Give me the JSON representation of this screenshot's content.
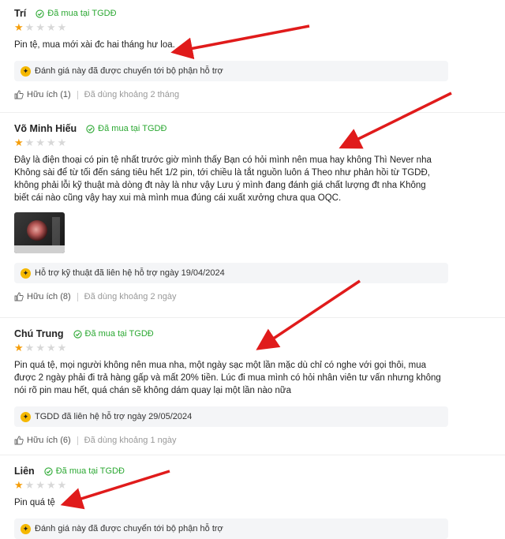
{
  "reviews": [
    {
      "name": "Trí",
      "verified": "Đã mua tại TGDĐ",
      "rating": 1,
      "content": "Pin tệ, mua mới xài đc hai tháng hư loa.",
      "reply": "Đánh giá này đã được chuyển tới bộ phận hỗ trợ",
      "helpful": "Hữu ích (1)",
      "used": "Đã dùng khoảng 2 tháng"
    },
    {
      "name": "Võ Minh Hiếu",
      "verified": "Đã mua tại TGDĐ",
      "rating": 1,
      "content": "Đây là điện thoại có pin tệ nhất trước giờ mình thấy Bạn có hỏi mình nên mua hay không Thì Never nha Không sài để từ tối đến sáng tiêu hết 1/2 pin, tới chiều là tắt nguồn luôn á Theo như phản hồi từ TGDĐ, không phải lỗi kỹ thuật mà dòng đt này là như vậy Lưu ý mình đang đánh giá chất lượng đt nha Không biết cái nào cũng vậy hay xui mà mình mua đúng cái xuất xưởng chưa qua OQC.",
      "reply": "Hỗ trợ kỹ thuật đã liên hệ hỗ trợ ngày 19/04/2024",
      "helpful": "Hữu ích (8)",
      "used": "Đã dùng khoảng 2 ngày"
    },
    {
      "name": "Chú Trung",
      "verified": "Đã mua tại TGDĐ",
      "rating": 1,
      "content": "Pin quá tệ, mọi người không nên mua nha, một ngày sạc một lần mặc dù chỉ có nghe với gọi thôi, mua được 2 ngày phải đi trả hàng gấp và mất 20% tiền. Lúc đi mua mình có hỏi nhân viên tư vấn nhưng không nói rõ pin mau hết, quá chán sẽ không dám quay lại một lần nào nữa",
      "reply": "TGDD đã liên hệ hỗ trợ ngày 29/05/2024",
      "helpful": "Hữu ích (6)",
      "used": "Đã dùng khoảng 1 ngày"
    },
    {
      "name": "Liên",
      "verified": "Đã mua tại TGDĐ",
      "rating": 1,
      "content": "Pin quá tệ",
      "reply": "Đánh giá này đã được chuyển tới bộ phận hỗ trợ"
    }
  ],
  "colors": {
    "verified": "#2ba832",
    "star_on": "#f59e0b",
    "star_off": "#d8d8d8",
    "arrow": "#e01b1b",
    "reply_bg": "#f4f5f7"
  },
  "icons": {
    "verified": "check-circle-icon",
    "support": "support-badge-icon",
    "like": "thumbs-up-icon",
    "star": "star-icon"
  }
}
